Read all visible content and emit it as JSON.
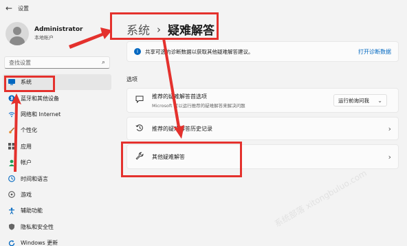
{
  "window": {
    "title": "设置"
  },
  "profile": {
    "name": "Administrator",
    "account_type": "本地帐户"
  },
  "search": {
    "placeholder": "查找设置"
  },
  "nav": [
    {
      "label": "系统",
      "icon": "monitor-icon",
      "active": true
    },
    {
      "label": "蓝牙和其他设备",
      "icon": "bluetooth-icon"
    },
    {
      "label": "网络和 Internet",
      "icon": "wifi-icon"
    },
    {
      "label": "个性化",
      "icon": "brush-icon"
    },
    {
      "label": "应用",
      "icon": "apps-icon"
    },
    {
      "label": "帐户",
      "icon": "person-icon"
    },
    {
      "label": "时间和语言",
      "icon": "globe-clock-icon"
    },
    {
      "label": "游戏",
      "icon": "gamepad-icon"
    },
    {
      "label": "辅助功能",
      "icon": "accessibility-icon"
    },
    {
      "label": "隐私和安全性",
      "icon": "shield-icon"
    },
    {
      "label": "Windows 更新",
      "icon": "update-icon"
    }
  ],
  "breadcrumb": {
    "parent": "系统",
    "separator": "›",
    "current": "疑难解答"
  },
  "info_banner": {
    "text": "共享可选的诊断数据以获取其他疑难解答建议。",
    "link": "打开诊断数据"
  },
  "section": {
    "title": "选项"
  },
  "options": {
    "recommended": {
      "title": "推荐的疑难解答首选项",
      "subtitle": "Microsoft 可以运行推荐的疑难解答来解决问题",
      "dropdown_value": "运行前询问我"
    },
    "history": {
      "title": "推荐的疑难解答历史记录"
    },
    "other": {
      "title": "其他疑难解答"
    }
  },
  "colors": {
    "accent": "#0067c0",
    "highlight": "#e4312d",
    "background": "#f3f3f3"
  },
  "watermark": "系统部落 xitongbuluo.com"
}
